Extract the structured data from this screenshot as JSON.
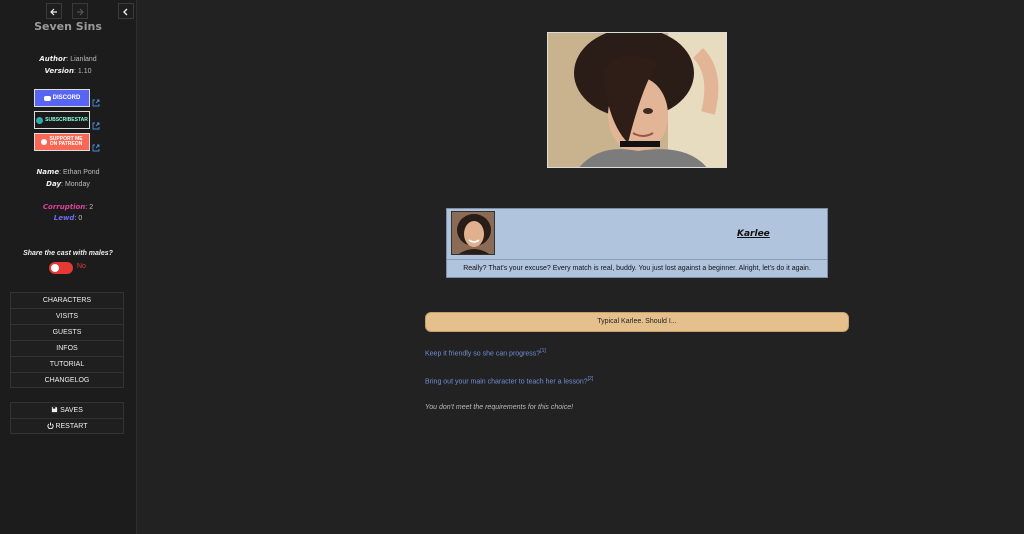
{
  "sidebar": {
    "title": "Seven Sins",
    "author_label": "Author",
    "author": "Lianland",
    "version_label": "Version",
    "version": "1.10",
    "banners": [
      {
        "label": "DISCORD",
        "color": "#5865f2"
      },
      {
        "label": "SUBSCRIBESTAR",
        "color": "#1a1a1a"
      },
      {
        "label": "SUPPORT ME ON PATREON",
        "color": "#f96854"
      }
    ],
    "name_label": "Name",
    "name": "Ethan Pond",
    "day_label": "Day",
    "day": "Monday",
    "corruption_label": "Corruption",
    "corruption": "2",
    "lewd_label": "Lewd",
    "lewd": "0",
    "share_question": "Share the cast with males?",
    "share_toggle": "No",
    "menu": [
      "CHARACTERS",
      "VISITS",
      "GUESTS",
      "INFOS",
      "TUTORIAL",
      "CHANGELOG"
    ],
    "saves": "SAVES",
    "restart": "RESTART"
  },
  "main": {
    "speaker": "Karlee",
    "dialog": "Really? That's your excuse? Every match is real, buddy. You just lost against a beginner. Alright, let's do it again.",
    "prompt": "Typical Karlee. Should I...",
    "choices": [
      {
        "text": "Keep it friendly so she can progress?",
        "sup": "[1]"
      },
      {
        "text": "Bring out your main character to teach her a lesson?",
        "sup": "[2]"
      }
    ],
    "requirement_note": "You don't meet the requirements for this choice!"
  },
  "colors": {
    "background": "#222222",
    "dialog_box": "#b0c4de",
    "prompt_bar": "#e6c08c",
    "choice_link": "#6e8fd6",
    "corruption": "#e0409a",
    "lewd": "#6a6cf0",
    "toggle_off": "#e53935"
  },
  "icons": [
    "back-arrow-icon",
    "forward-arrow-icon",
    "collapse-chevron-icon",
    "external-link-icon",
    "save-icon",
    "power-icon"
  ]
}
